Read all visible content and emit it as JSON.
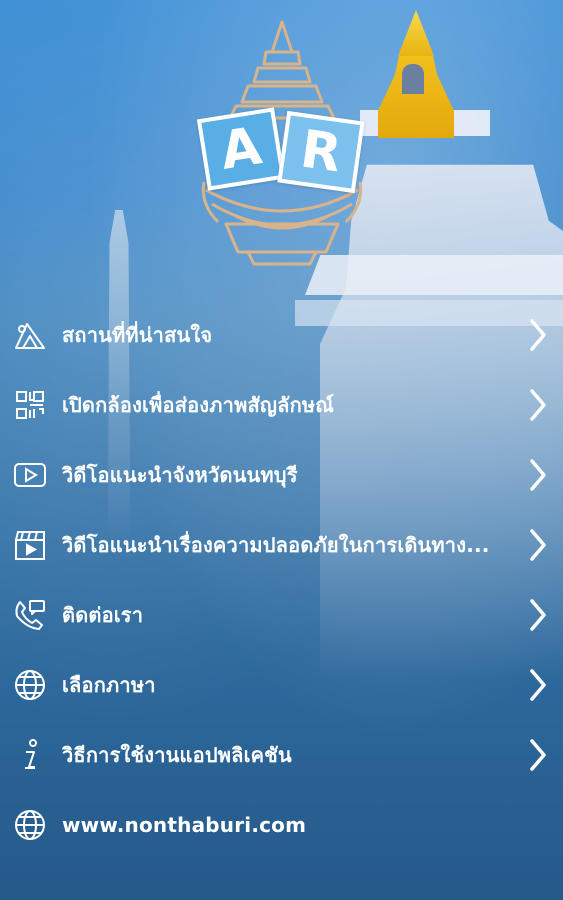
{
  "logo": {
    "letters": [
      "A",
      "R"
    ],
    "icon": "nonthaburi-emblem-icon"
  },
  "menu": [
    {
      "label": "สถานที่ที่น่าสนใจ",
      "icon": "landmark-icon",
      "has_chevron": true
    },
    {
      "label": "เปิดกล้องเพื่อส่องภาพสัญลักษณ์",
      "icon": "qr-scan-icon",
      "has_chevron": true
    },
    {
      "label": "วิดีโอแนะนำจังหวัดนนทบุรี",
      "icon": "video-play-icon",
      "has_chevron": true
    },
    {
      "label": "วิดีโอแนะนำเรื่องความปลอดภัยในการเดินทาง...",
      "icon": "film-clapper-icon",
      "has_chevron": true
    },
    {
      "label": "ติดต่อเรา",
      "icon": "phone-message-icon",
      "has_chevron": true
    },
    {
      "label": "เลือกภาษา",
      "icon": "globe-icon",
      "has_chevron": true
    },
    {
      "label": "วิธีการใช้งานแอปพลิเคชัน",
      "icon": "info-icon",
      "has_chevron": true
    },
    {
      "label": "www.nonthaburi.com",
      "icon": "globe-icon",
      "has_chevron": false
    }
  ],
  "colors": {
    "text": "#ffffff",
    "ar_tile": "#6fb8ea",
    "emblem_stroke": "#d9b38a"
  }
}
